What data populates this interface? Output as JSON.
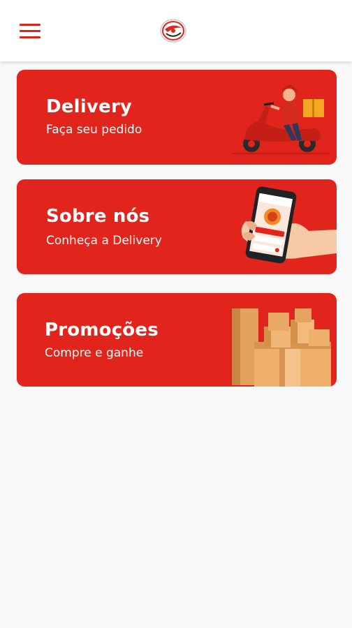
{
  "app": {
    "title": "Delivery",
    "accent_color": "#e2251c",
    "menu_icon": "hamburger-menu-icon",
    "logo_icon": "brand-logo-icon"
  },
  "cards": [
    {
      "title": "Delivery",
      "subtitle": "Faça seu pedido",
      "icon": "scooter-courier-illustration"
    },
    {
      "title": "Sobre nós",
      "subtitle": "Conheça a Delivery",
      "icon": "phone-in-hand-illustration"
    },
    {
      "title": "Promoções",
      "subtitle": "Compre e ganhe",
      "icon": "boxes-illustration"
    }
  ]
}
